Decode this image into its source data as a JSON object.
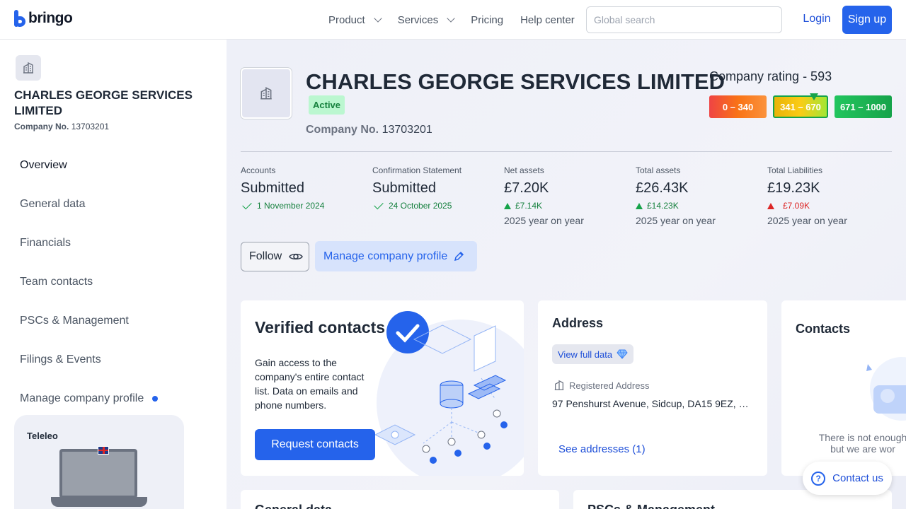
{
  "header": {
    "brand": "bringo",
    "nav": [
      {
        "label": "Product",
        "dropdown": true
      },
      {
        "label": "Services",
        "dropdown": true
      },
      {
        "label": "Pricing",
        "dropdown": false
      },
      {
        "label": "Help center",
        "dropdown": false
      }
    ],
    "search_placeholder": "Global search",
    "login_label": "Login",
    "signup_label": "Sign up"
  },
  "sidebar": {
    "company_name": "CHARLES GEORGE SERVICES LIMITED",
    "company_no_label": "Company No.",
    "company_no": "13703201",
    "menu": [
      {
        "label": "Overview",
        "active": true
      },
      {
        "label": "General data"
      },
      {
        "label": "Financials"
      },
      {
        "label": "Team contacts"
      },
      {
        "label": "PSCs & Management"
      },
      {
        "label": "Filings & Events"
      },
      {
        "label": "Manage company profile",
        "dot": true
      }
    ],
    "promo_brand": "Teleleo"
  },
  "company": {
    "name": "CHARLES GEORGE SERVICES LIMITED",
    "status": "Active",
    "company_no_label": "Company No.",
    "company_no": "13703201",
    "rating_title": "Company rating - 593",
    "rating_value": 593,
    "rating_bands": [
      "0 – 340",
      "341 – 670",
      "671 – 1000"
    ]
  },
  "stats": [
    {
      "label": "Accounts",
      "value": "Submitted",
      "sub": "1 November 2024",
      "sub_type": "check"
    },
    {
      "label": "Confirmation Statement",
      "value": "Submitted",
      "sub": "24 October 2025",
      "sub_type": "check"
    },
    {
      "label": "Net assets",
      "value": "£7.20K",
      "sub": "£7.14K",
      "sub_type": "up",
      "yoy": "2025 year on year"
    },
    {
      "label": "Total assets",
      "value": "£26.43K",
      "sub": "£14.23K",
      "sub_type": "up",
      "yoy": "2025 year on year"
    },
    {
      "label": "Total Liabilities",
      "value": "£19.23K",
      "sub": "£7.09K",
      "sub_type": "up-red",
      "yoy": "2025 year on year"
    }
  ],
  "actions": {
    "follow_label": "Follow",
    "manage_label": "Manage company profile"
  },
  "verified": {
    "title": "Verified contacts",
    "text": "Gain access to the company's entire contact list. Data on emails and phone numbers.",
    "button": "Request contacts"
  },
  "address": {
    "title": "Address",
    "view_full": "View full data",
    "registered_label": "Registered Address",
    "registered_value": "97 Penshurst Avenue, Sidcup, DA15 9EZ, En...",
    "see_addresses": "See addresses (1)"
  },
  "contacts": {
    "title": "Contacts",
    "empty_line1": "There is not enough",
    "empty_line2": "but we are wor"
  },
  "bottom_cards": {
    "left_title": "General data",
    "right_title": "PSCs & Management"
  },
  "contact_us": "Contact us"
}
